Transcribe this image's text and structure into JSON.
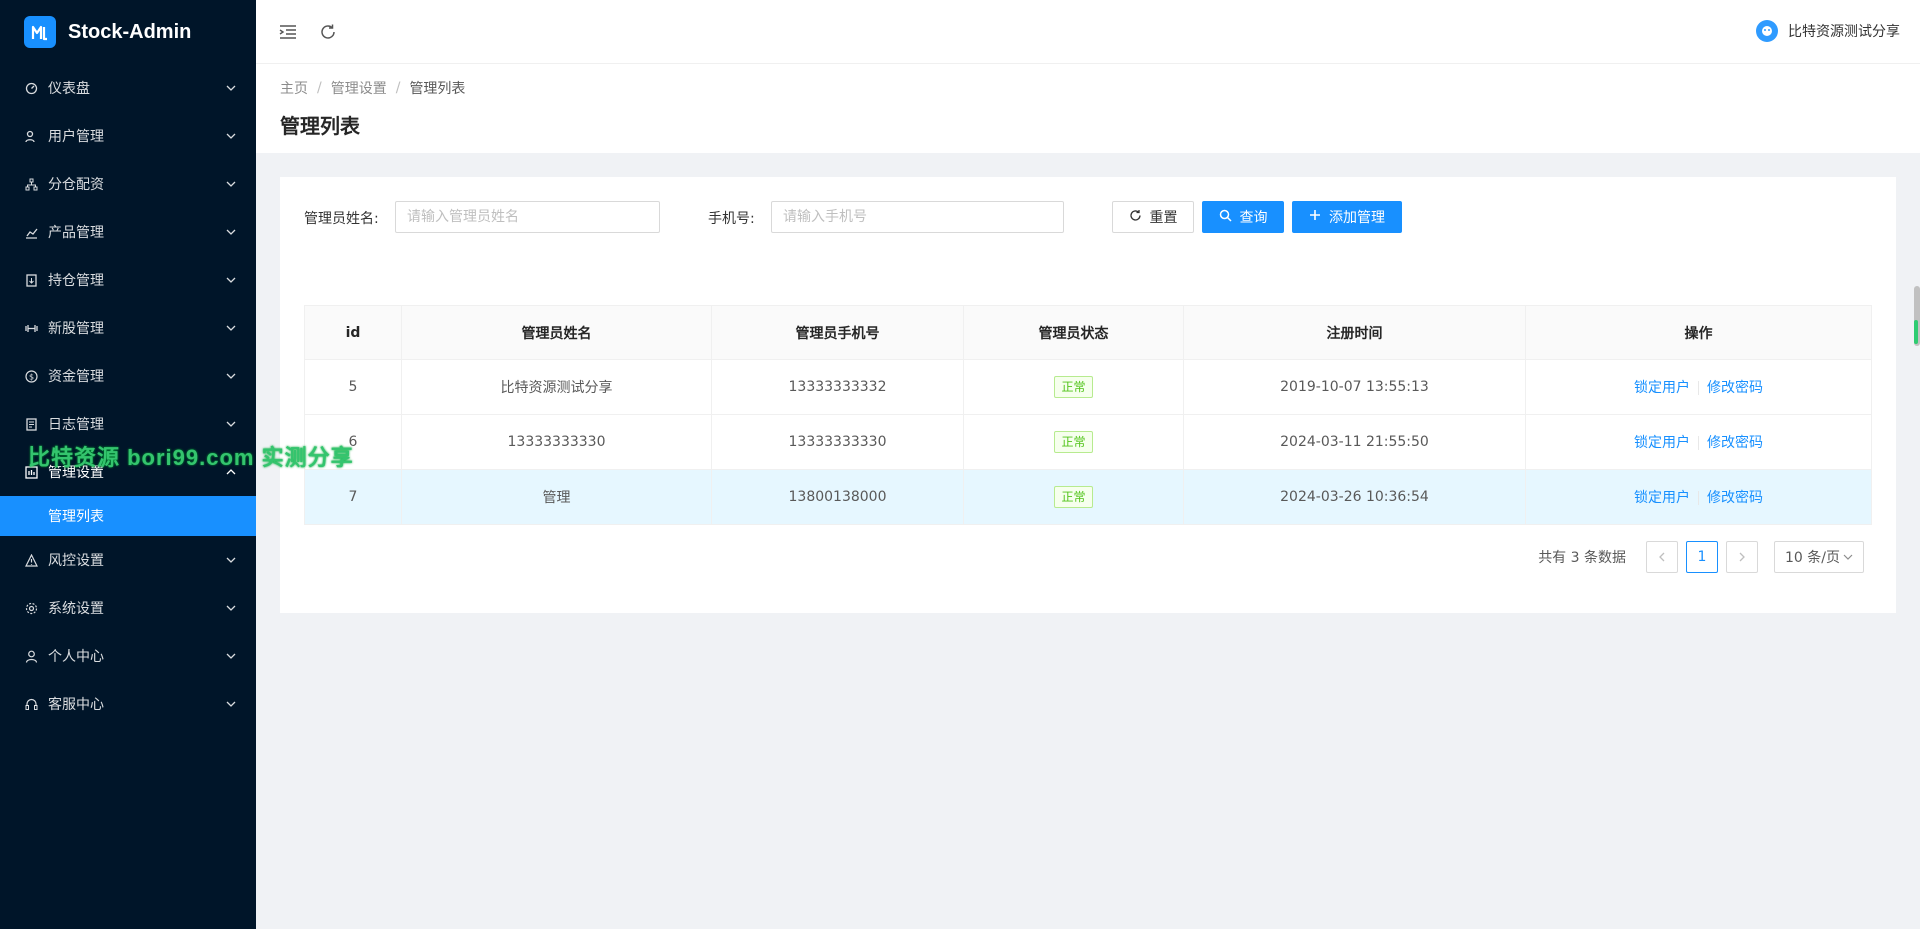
{
  "app": {
    "title": "Stock-Admin",
    "logo_letter": "Mb"
  },
  "sidebar": {
    "items": [
      {
        "label": "仪表盘",
        "icon": "dashboard-icon"
      },
      {
        "label": "用户管理",
        "icon": "user-manage-icon"
      },
      {
        "label": "分仓配资",
        "icon": "sitemap-icon"
      },
      {
        "label": "产品管理",
        "icon": "chart-icon"
      },
      {
        "label": "持仓管理",
        "icon": "position-icon"
      },
      {
        "label": "新股管理",
        "icon": "barbell-icon"
      },
      {
        "label": "资金管理",
        "icon": "dollar-icon"
      },
      {
        "label": "日志管理",
        "icon": "log-icon"
      },
      {
        "label": "管理设置",
        "icon": "admin-icon",
        "open": true
      },
      {
        "label": "风控设置",
        "icon": "warning-icon"
      },
      {
        "label": "系统设置",
        "icon": "gear-icon"
      },
      {
        "label": "个人中心",
        "icon": "person-icon"
      },
      {
        "label": "客服中心",
        "icon": "headset-icon"
      }
    ],
    "active_sub": "管理列表"
  },
  "header": {
    "user_name": "比特资源测试分享"
  },
  "breadcrumb": [
    "主页",
    "管理设置",
    "管理列表"
  ],
  "page_title": "管理列表",
  "search": {
    "name_label": "管理员姓名:",
    "name_placeholder": "请输入管理员姓名",
    "phone_label": "手机号:",
    "phone_placeholder": "请输入手机号",
    "reset_label": "重置",
    "query_label": "查询",
    "add_label": "添加管理"
  },
  "table": {
    "headers": [
      "id",
      "管理员姓名",
      "管理员手机号",
      "管理员状态",
      "注册时间",
      "操作"
    ],
    "rows": [
      {
        "id": "5",
        "name": "比特资源测试分享",
        "phone": "13333333332",
        "status": "正常",
        "time": "2019-10-07 13:55:13"
      },
      {
        "id": "6",
        "name": "13333333330",
        "phone": "13333333330",
        "status": "正常",
        "time": "2024-03-11 21:55:50"
      },
      {
        "id": "7",
        "name": "管理",
        "phone": "13800138000",
        "status": "正常",
        "time": "2024-03-26 10:36:54"
      }
    ],
    "action_lock": "锁定用户",
    "action_password": "修改密码"
  },
  "pagination": {
    "total_text": "共有 3 条数据",
    "current_page": "1",
    "page_size": "10 条/页"
  },
  "watermark": "比特资源 bori99.com 实测分享",
  "colors": {
    "sidebar_bg": "#001529",
    "primary": "#1890ff",
    "success": "#52c41a"
  }
}
